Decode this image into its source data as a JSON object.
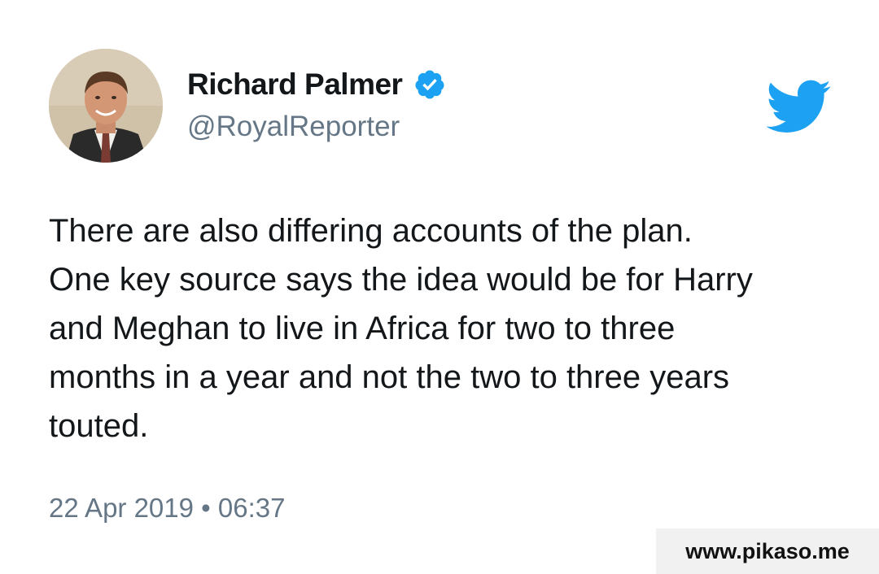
{
  "author": {
    "display_name": "Richard Palmer",
    "handle": "@RoyalReporter",
    "verified": true,
    "avatar_icon": "profile-photo",
    "verified_icon": "verified-badge-icon"
  },
  "platform": {
    "icon": "twitter-bird-icon",
    "brand_color": "#1DA1F2"
  },
  "tweet": {
    "text_lines": [
      "There are also differing accounts of the plan.",
      "One key source says the idea would be for Harry",
      "and Meghan to live in Africa for two to three",
      "months in a year and not the two to three years",
      "touted."
    ],
    "timestamp": "22 Apr 2019 • 06:37"
  },
  "watermark": {
    "text": "www.pikaso.me"
  }
}
